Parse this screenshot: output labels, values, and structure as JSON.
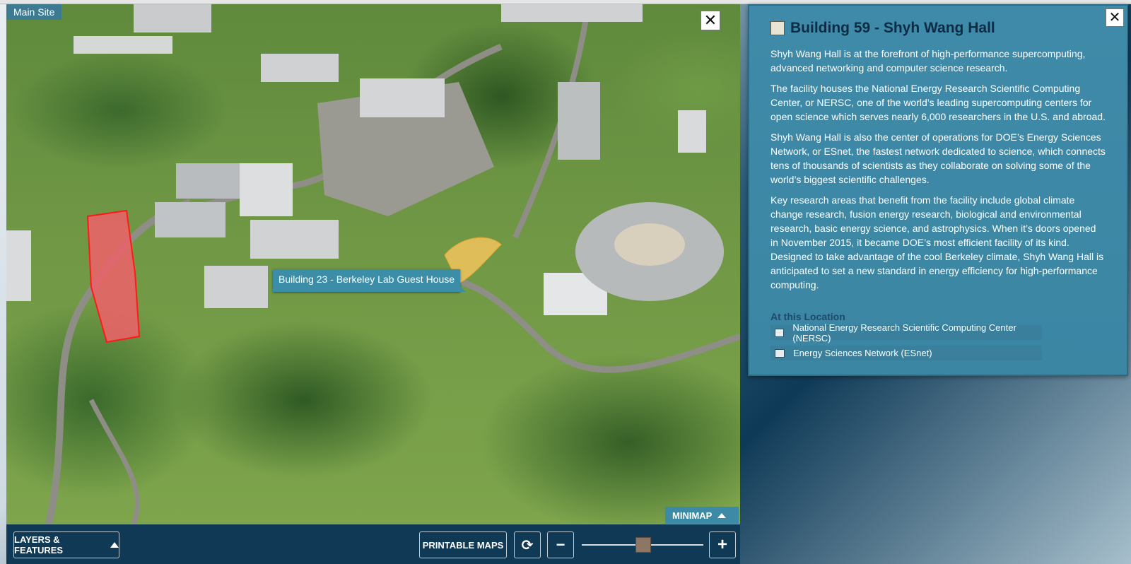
{
  "map": {
    "site_label": "Main Site",
    "close_label": "✕",
    "tooltip": "Building 23 - Berkeley Lab Guest House",
    "minimap_label": "MINIMAP"
  },
  "controls": {
    "layers_label": "LAYERS & FEATURES",
    "printable_label": "PRINTABLE MAPS",
    "refresh_label": "⟳",
    "zoom_out_label": "−",
    "zoom_in_label": "+"
  },
  "panel": {
    "close_label": "✕",
    "title": "Building 59 - Shyh Wang Hall",
    "paragraphs": [
      "Shyh Wang Hall is at the forefront of high-performance supercomputing, advanced networking and computer science research.",
      "The facility houses the National Energy Research Scientific Computing Center, or NERSC, one of the world’s leading supercomputing centers for open science which serves nearly 6,000 researchers in the U.S. and abroad.",
      "Shyh Wang Hall is also the center of operations for DOE’s Energy Sciences Network, or ESnet, the fastest network dedicated to science, which connects tens of thousands of scientists as they collaborate on solving some of the world’s biggest scientific challenges.",
      "Key research areas that benefit from the facility include global climate change research, fusion energy research, biological and environmental research, basic energy science, and astrophysics. When it’s doors opened in November 2015, it became DOE’s most efficient facility of its kind. Designed to take advantage of the cool Berkeley climate, Shyh Wang Hall is anticipated to set a new standard in energy efficiency for high-performance computing."
    ],
    "location_title": "At this Location",
    "locations": [
      "National Energy Research Scientific Computing Center (NERSC)",
      "Energy Sciences Network (ESnet)"
    ]
  },
  "colors": {
    "highlight_building": "#f0606a",
    "hover_building": "#f2c35c",
    "panel_bg": "#3f8aa8",
    "control_bar": "#0f3954"
  }
}
